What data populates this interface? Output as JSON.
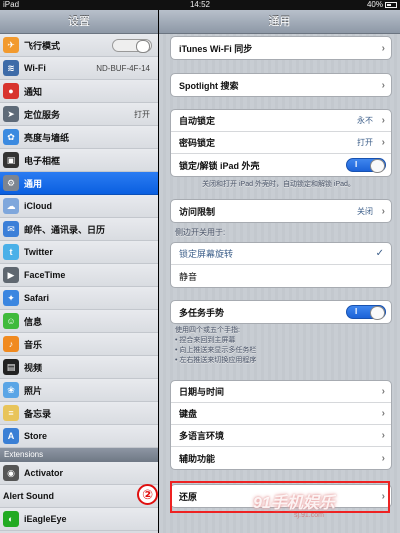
{
  "status": {
    "carrier": "iPad",
    "time": "14:52",
    "battery_percent": "40%",
    "battery_level": 0.4
  },
  "left": {
    "title": "设置",
    "items": [
      {
        "label": "飞行模式",
        "icon": "airplane-icon",
        "color": "#f29a2e",
        "glyph": "✈"
      },
      {
        "label": "Wi-Fi",
        "icon": "wifi-icon",
        "color": "#3d6ba8",
        "glyph": "≋",
        "value": "ND-BUF-4F-14"
      },
      {
        "label": "通知",
        "icon": "notification-icon",
        "color": "#d8342e",
        "glyph": "●"
      },
      {
        "label": "定位服务",
        "icon": "location-icon",
        "color": "#5e6a78",
        "glyph": "➤",
        "value": "打开"
      },
      {
        "label": "亮度与墙纸",
        "icon": "brightness-icon",
        "color": "#3b8ae0",
        "glyph": "✿"
      },
      {
        "label": "电子相框",
        "icon": "picture-frame-icon",
        "color": "#333",
        "glyph": "▣"
      },
      {
        "label": "通用",
        "icon": "gear-icon",
        "color": "#7d8590",
        "glyph": "⚙"
      },
      {
        "label": "iCloud",
        "icon": "cloud-icon",
        "color": "#7fa7dc",
        "glyph": "☁"
      },
      {
        "label": "邮件、通讯录、日历",
        "icon": "mail-icon",
        "color": "#3b7fd8",
        "glyph": "✉"
      },
      {
        "label": "Twitter",
        "icon": "twitter-icon",
        "color": "#4ab0e8",
        "glyph": "t"
      },
      {
        "label": "FaceTime",
        "icon": "facetime-icon",
        "color": "#5f6770",
        "glyph": "▶"
      },
      {
        "label": "Safari",
        "icon": "safari-icon",
        "color": "#3b86e0",
        "glyph": "✦"
      },
      {
        "label": "信息",
        "icon": "messages-icon",
        "color": "#3fba3b",
        "glyph": "☺"
      },
      {
        "label": "音乐",
        "icon": "music-icon",
        "color": "#f08a20",
        "glyph": "♪"
      },
      {
        "label": "视频",
        "icon": "video-icon",
        "color": "#222",
        "glyph": "▤"
      },
      {
        "label": "照片",
        "icon": "photos-icon",
        "color": "#5aa5e6",
        "glyph": "❀"
      },
      {
        "label": "备忘录",
        "icon": "notes-icon",
        "color": "#e8c45a",
        "glyph": "≡"
      },
      {
        "label": "Store",
        "icon": "store-icon",
        "color": "#3a7fd5",
        "glyph": "A"
      }
    ],
    "section_title": "Extensions",
    "extensions": [
      {
        "label": "Activator",
        "icon": "activator-icon",
        "color": "#555",
        "glyph": "◉"
      },
      {
        "label": "Alert Sound"
      },
      {
        "label": "iEagleEye",
        "icon": "eagle-icon",
        "color": "#2a2",
        "glyph": "◐"
      }
    ]
  },
  "right": {
    "title": "通用",
    "itunes_wifi": "iTunes Wi-Fi 同步",
    "spotlight": "Spotlight 搜索",
    "autolock": {
      "label": "自动锁定",
      "value": "永不"
    },
    "passcode": {
      "label": "密码锁定",
      "value": "打开"
    },
    "cover_lock": {
      "label": "锁定/解锁 iPad 外壳",
      "toggle": "I"
    },
    "cover_note": "关闭和打开 iPad 外壳时，自动锁定和解锁 iPad。",
    "restrictions": {
      "label": "访问限制",
      "value": "关闭"
    },
    "side_switch_title": "侧边开关用于:",
    "side_switch": [
      "锁定屏幕旋转",
      "静音"
    ],
    "multitasking": {
      "label": "多任务手势",
      "toggle": "I"
    },
    "gesture_note": [
      "使用四个或五个手指:",
      "• 捏合来回到主屏幕",
      "• 向上推送来显示多任务栏",
      "• 左右推送来切换应用程序"
    ],
    "group_date": [
      "日期与时间",
      "键盘",
      "多语言环境",
      "辅助功能"
    ],
    "reset": "还原",
    "callout_number": "②"
  },
  "watermark": {
    "brand": "91手机娱乐",
    "site": "sj.91.com"
  },
  "colors": {
    "accent": "#1c62d8",
    "callout": "#ee2222"
  }
}
